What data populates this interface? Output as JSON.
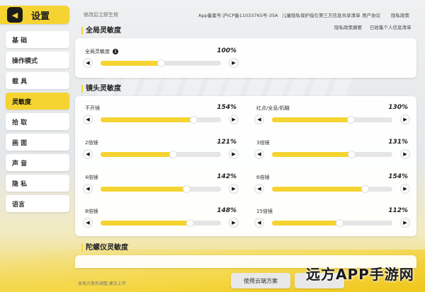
{
  "header": {
    "title": "设置",
    "back_icon": "back-arrow-icon"
  },
  "sidebar": {
    "items": [
      {
        "label": "基 础"
      },
      {
        "label": "操作模式"
      },
      {
        "label": "载 具"
      },
      {
        "label": "灵敏度",
        "active": true
      },
      {
        "label": "拾 取"
      },
      {
        "label": "画 面"
      },
      {
        "label": "声 音"
      },
      {
        "label": "隐 私"
      },
      {
        "label": "语言"
      }
    ]
  },
  "topbar": {
    "note": "修改后立即生效",
    "links": [
      "App备案号:沪ICP备11033765号-35A",
      "儿童隐私保护指引",
      "第三方信息共享清单",
      "用户协议",
      "隐私政策",
      "隐私政策摘要",
      "已收集个人信息清单"
    ]
  },
  "sections": {
    "global": {
      "title": "全局灵敏度",
      "slider": {
        "label": "全局灵敏度",
        "value": "100%",
        "fill": 0.5
      }
    },
    "scope": {
      "title": "镜头灵敏度",
      "sliders": [
        {
          "label": "不开镜",
          "value": "154%",
          "fill": 0.77
        },
        {
          "label": "红点/全息/机瞄",
          "value": "130%",
          "fill": 0.65
        },
        {
          "label": "2倍镜",
          "value": "121%",
          "fill": 0.6
        },
        {
          "label": "3倍镜",
          "value": "131%",
          "fill": 0.66
        },
        {
          "label": "4倍镜",
          "value": "142%",
          "fill": 0.71
        },
        {
          "label": "6倍镜",
          "value": "154%",
          "fill": 0.77
        },
        {
          "label": "8倍镜",
          "value": "148%",
          "fill": 0.74
        },
        {
          "label": "15倍镜",
          "value": "112%",
          "fill": 0.56
        }
      ]
    },
    "gyro": {
      "title": "陀螺仪灵敏度"
    }
  },
  "bottom": {
    "note": "本地方案有调整,建议上传",
    "cloud_button": "使用云端方案"
  },
  "watermark": {
    "text": "远方APP手游网"
  },
  "colors": {
    "accent": "#f5d432",
    "track": "#e5e5e5",
    "dark": "#1c1c1c"
  }
}
